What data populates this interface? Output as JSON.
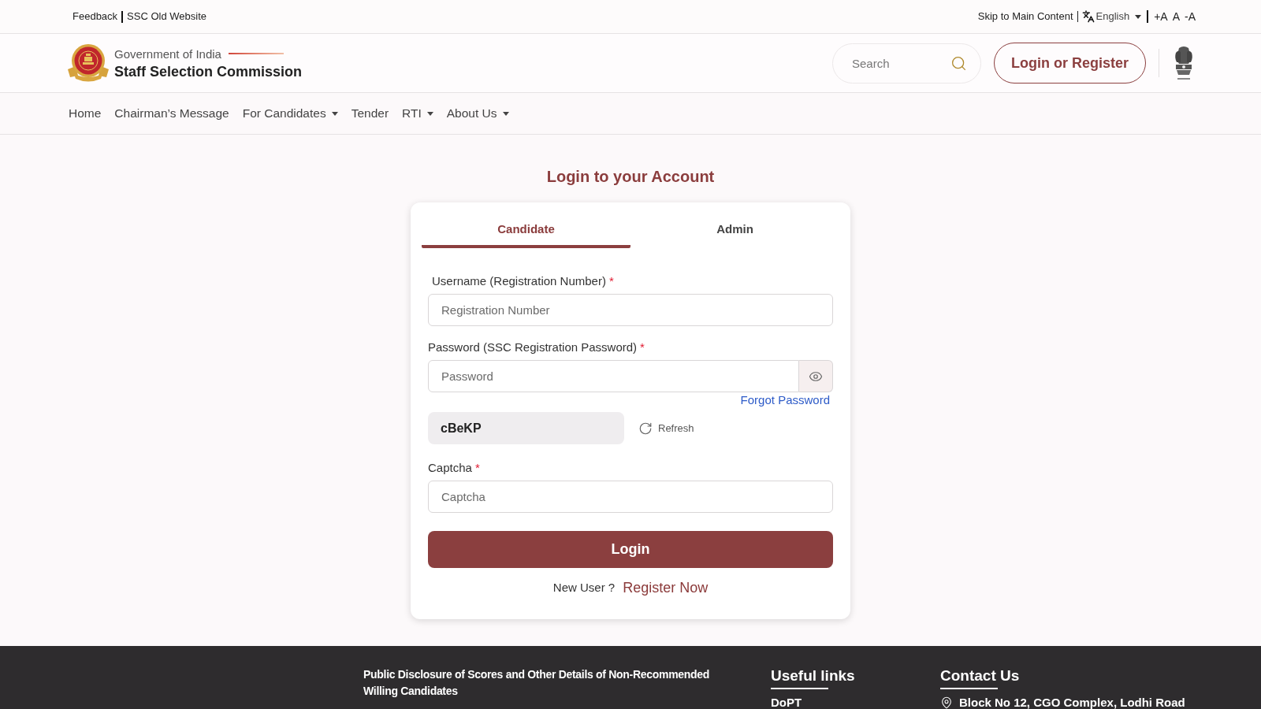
{
  "top_bar": {
    "left_links": [
      "Feedback",
      "SSC Old Website"
    ],
    "skip_link": "Skip to Main Content",
    "language": "English",
    "font_size_controls": [
      "+A",
      "A",
      "-A"
    ]
  },
  "header": {
    "org_line": "Government of India",
    "org_name": "Staff Selection Commission",
    "search": {
      "placeholder": "Search"
    },
    "login_button": "Login or Register"
  },
  "nav": [
    {
      "label": "Home",
      "dropdown": false
    },
    {
      "label": "Chairman’s Message",
      "dropdown": false
    },
    {
      "label": "For Candidates",
      "dropdown": true
    },
    {
      "label": "Tender",
      "dropdown": false
    },
    {
      "label": "RTI",
      "dropdown": true
    },
    {
      "label": "About Us",
      "dropdown": true
    }
  ],
  "login": {
    "title": "Login to your Account",
    "tabs": [
      {
        "label": "Candidate",
        "selected": true
      },
      {
        "label": "Admin",
        "selected": false
      }
    ],
    "form": [
      {
        "kind": "text",
        "label": "Username (Registration Number)",
        "required_mark": "*",
        "placeholder": "Registration Number"
      },
      {
        "kind": "password",
        "label": "Password (SSC Registration Password)",
        "required_mark": "*",
        "placeholder": "Password",
        "link": "Forgot Password"
      },
      {
        "kind": "captcha_code",
        "code": "cBeKP",
        "refresh": "Refresh"
      },
      {
        "kind": "text",
        "label": "Captcha",
        "required_mark": "*",
        "placeholder": "Captcha"
      }
    ],
    "submit": "Login",
    "new_user": {
      "prompt": "New User ?",
      "link": "Register Now"
    }
  },
  "footer": {
    "disclosure": "Public Disclosure of Scores and Other Details of Non-Recommended Willing Candidates",
    "columns": [
      {
        "heading": "Useful links",
        "items": [
          {
            "kind": "link",
            "text": "DoPT"
          }
        ]
      },
      {
        "heading": "Contact Us",
        "items": [
          {
            "kind": "address",
            "text": "Block No 12, CGO Complex, Lodhi Road"
          }
        ]
      }
    ]
  }
}
